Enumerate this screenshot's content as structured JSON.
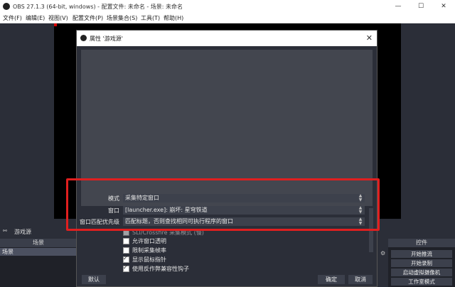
{
  "titlebar": {
    "title": "OBS 27.1.3 (64-bit, windows) - 配置文件: 未命名 - 场景: 未命名",
    "minimize": "—",
    "maximize": "☐",
    "close": "✕"
  },
  "menu": [
    "文件(F)",
    "编辑(E)",
    "视图(V)",
    "配置文件(P)",
    "场景集合(S)",
    "工具(T)",
    "帮助(H)"
  ],
  "source_name": "游戏源",
  "scenes": {
    "header": "场景",
    "items": [
      "场景"
    ]
  },
  "controls": {
    "header": "控件",
    "buttons": [
      "开始推流",
      "开始录制",
      "启动虚拟摄像机",
      "工作室模式"
    ]
  },
  "dialog": {
    "title": "属性 '游戏源'",
    "close": "✕",
    "fields": [
      {
        "label": "模式",
        "value": "采集特定窗口"
      },
      {
        "label": "窗口",
        "value": "[launcher.exe]: 崩坏: 星穹铁道"
      },
      {
        "label": "窗口匹配优先级",
        "value": "匹配标题，否则查找相同可执行程序的窗口"
      }
    ],
    "partial_row": "SLI/Crossfire 采集模式 (慢)",
    "checkboxes": [
      {
        "label": "允许窗口透明",
        "checked": false
      },
      {
        "label": "限制采集帧率",
        "checked": false
      },
      {
        "label": "显示鼠标指针",
        "checked": true
      },
      {
        "label": "使用反作弊兼容性钩子",
        "checked": true
      }
    ],
    "defaults_button": "默认",
    "ok_button": "确定",
    "cancel_button": "取消"
  },
  "colors": {
    "highlight": "#e01f1f",
    "background": "#2b2e38"
  }
}
